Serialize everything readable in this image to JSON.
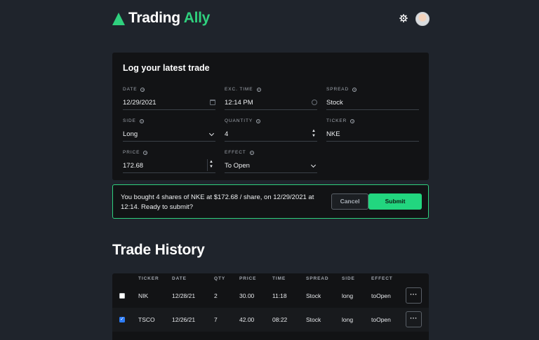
{
  "brand": {
    "name": "Trading",
    "accent": "Ally",
    "accent_color": "#2fd07e"
  },
  "header": {
    "settings_icon": "gear-icon",
    "avatar_icon": "user-avatar"
  },
  "form": {
    "title": "Log your latest trade",
    "fields": {
      "date": {
        "label": "DATE",
        "value": "12/29/2021"
      },
      "exc_time": {
        "label": "EXC. TIME",
        "value": "12:14 PM"
      },
      "spread": {
        "label": "SPREAD",
        "value": "Stock"
      },
      "side": {
        "label": "SIDE",
        "value": "Long"
      },
      "quantity": {
        "label": "QUANTITY",
        "value": "4"
      },
      "ticker": {
        "label": "TICKER",
        "value": "NKE"
      },
      "price": {
        "label": "PRICE",
        "value": "172.68"
      },
      "effect": {
        "label": "EFFECT",
        "value": "To Open"
      }
    },
    "help_glyph": "?"
  },
  "confirm": {
    "message": "You bought 4 shares of NKE at $172.68 / share, on 12/29/2021 at 12:14. Ready to submit?",
    "cancel_label": "Cancel",
    "submit_label": "Submit"
  },
  "history": {
    "title": "Trade History",
    "columns": [
      "TICKER",
      "DATE",
      "QTY",
      "PRICE",
      "TIME",
      "SPREAD",
      "SIDE",
      "EFFECT"
    ],
    "rows": [
      {
        "checked": false,
        "ticker": "NIK",
        "date": "12/28/21",
        "qty": "2",
        "price": "30.00",
        "time": "11:18",
        "spread": "Stock",
        "side": "long",
        "effect": "toOpen"
      },
      {
        "checked": true,
        "ticker": "TSCO",
        "date": "12/26/21",
        "qty": "7",
        "price": "42.00",
        "time": "08:22",
        "spread": "Stock",
        "side": "long",
        "effect": "toOpen"
      }
    ],
    "more_label": "···"
  }
}
